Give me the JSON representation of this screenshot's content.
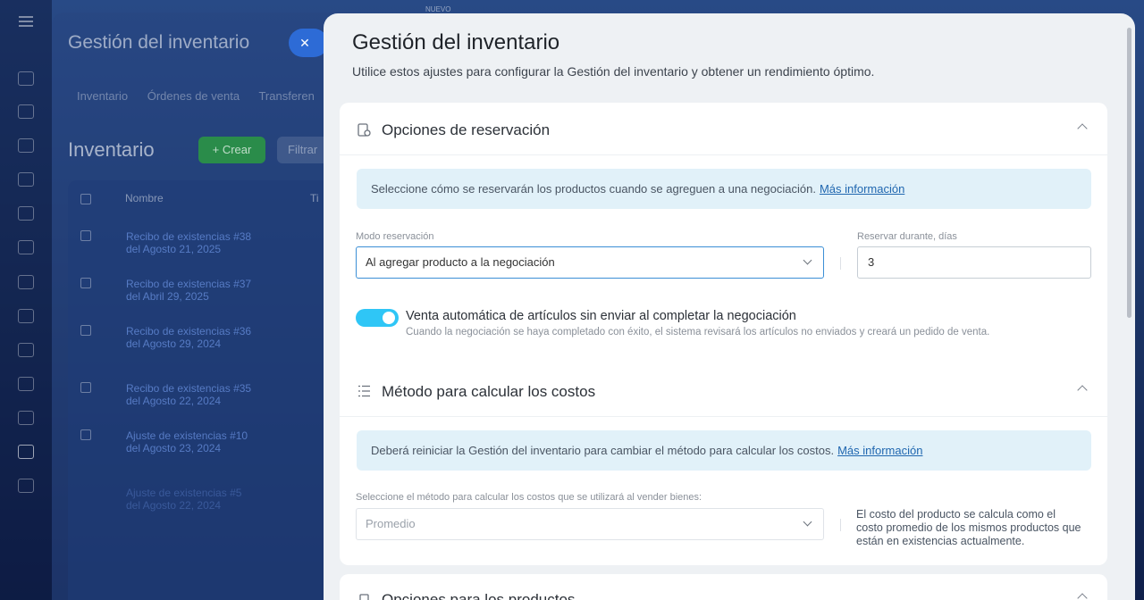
{
  "background": {
    "top_badge": "NUEVO",
    "panel_title": "Gestión del inventario",
    "close_label": "✕",
    "tabs": [
      "Inventario",
      "Órdenes de venta",
      "Transferen"
    ],
    "heading": "Inventario",
    "create_label": "+ Crear",
    "filter_label": "Filtrar",
    "table_header": "Nombre",
    "table_header_2": "Ti",
    "rows": [
      "Recibo de existencias #38\ndel Agosto 21, 2025",
      "Recibo de existencias #37\ndel Abril 29, 2025",
      "Recibo de existencias #36\ndel Agosto 29, 2024",
      "Recibo de existencias #35\ndel Agosto 22, 2024",
      "Ajuste de existencias #10\ndel Agosto 23, 2024",
      "Ajuste de existencias #5\ndel Agosto 22, 2024"
    ]
  },
  "slider": {
    "title": "Gestión del inventario",
    "description": "Utilice estos ajustes para configurar la Gestión del inventario y obtener un rendimiento óptimo."
  },
  "reservation": {
    "title": "Opciones de reservación",
    "info": "Seleccione cómo se reservarán los productos cuando se agreguen a una negociación.",
    "info_link": "Más información",
    "mode_label": "Modo reservación",
    "mode_value": "Al agregar producto a la negociación",
    "days_label": "Reservar durante, días",
    "days_value": "3"
  },
  "auto_sale": {
    "enabled": true,
    "title": "Venta automática de artículos sin enviar al completar la negociación",
    "subtitle": "Cuando la negociación se haya completado con éxito, el sistema revisará los artículos no enviados y creará un pedido de venta."
  },
  "cost_method": {
    "title": "Método para calcular los costos",
    "info": "Deberá reiniciar la Gestión del inventario para cambiar el método para calcular los costos.",
    "info_link": "Más información",
    "select_label": "Seleccione el método para calcular los costos que se utilizará al vender bienes:",
    "select_value": "Promedio",
    "note": "El costo del producto se calcula como el costo promedio de los mismos productos que están en existencias actualmente."
  },
  "product_options": {
    "title": "Opciones para los productos"
  },
  "colors": {
    "toggle_on": "#2fc6f6",
    "link": "#2067b0",
    "info_bg": "#e1f1f9"
  }
}
